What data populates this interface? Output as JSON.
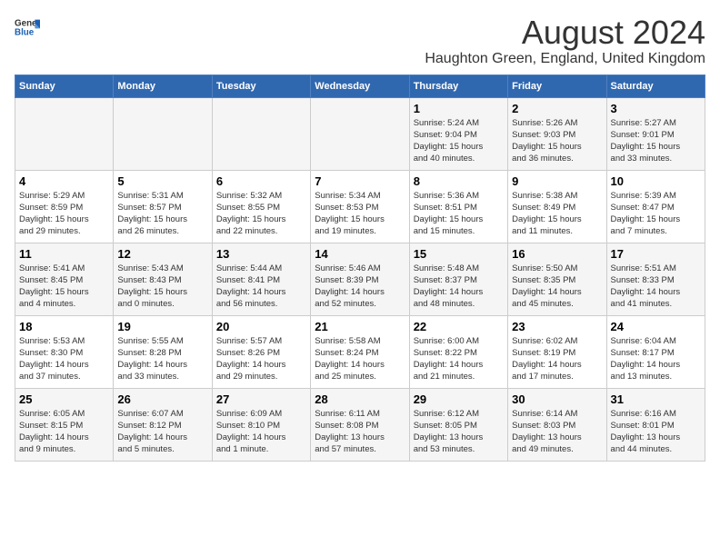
{
  "header": {
    "logo_general": "General",
    "logo_blue": "Blue",
    "title": "August 2024",
    "subtitle": "Haughton Green, England, United Kingdom"
  },
  "calendar": {
    "days_of_week": [
      "Sunday",
      "Monday",
      "Tuesday",
      "Wednesday",
      "Thursday",
      "Friday",
      "Saturday"
    ],
    "weeks": [
      [
        {
          "day": "",
          "info": ""
        },
        {
          "day": "",
          "info": ""
        },
        {
          "day": "",
          "info": ""
        },
        {
          "day": "",
          "info": ""
        },
        {
          "day": "1",
          "info": "Sunrise: 5:24 AM\nSunset: 9:04 PM\nDaylight: 15 hours\nand 40 minutes."
        },
        {
          "day": "2",
          "info": "Sunrise: 5:26 AM\nSunset: 9:03 PM\nDaylight: 15 hours\nand 36 minutes."
        },
        {
          "day": "3",
          "info": "Sunrise: 5:27 AM\nSunset: 9:01 PM\nDaylight: 15 hours\nand 33 minutes."
        }
      ],
      [
        {
          "day": "4",
          "info": "Sunrise: 5:29 AM\nSunset: 8:59 PM\nDaylight: 15 hours\nand 29 minutes."
        },
        {
          "day": "5",
          "info": "Sunrise: 5:31 AM\nSunset: 8:57 PM\nDaylight: 15 hours\nand 26 minutes."
        },
        {
          "day": "6",
          "info": "Sunrise: 5:32 AM\nSunset: 8:55 PM\nDaylight: 15 hours\nand 22 minutes."
        },
        {
          "day": "7",
          "info": "Sunrise: 5:34 AM\nSunset: 8:53 PM\nDaylight: 15 hours\nand 19 minutes."
        },
        {
          "day": "8",
          "info": "Sunrise: 5:36 AM\nSunset: 8:51 PM\nDaylight: 15 hours\nand 15 minutes."
        },
        {
          "day": "9",
          "info": "Sunrise: 5:38 AM\nSunset: 8:49 PM\nDaylight: 15 hours\nand 11 minutes."
        },
        {
          "day": "10",
          "info": "Sunrise: 5:39 AM\nSunset: 8:47 PM\nDaylight: 15 hours\nand 7 minutes."
        }
      ],
      [
        {
          "day": "11",
          "info": "Sunrise: 5:41 AM\nSunset: 8:45 PM\nDaylight: 15 hours\nand 4 minutes."
        },
        {
          "day": "12",
          "info": "Sunrise: 5:43 AM\nSunset: 8:43 PM\nDaylight: 15 hours\nand 0 minutes."
        },
        {
          "day": "13",
          "info": "Sunrise: 5:44 AM\nSunset: 8:41 PM\nDaylight: 14 hours\nand 56 minutes."
        },
        {
          "day": "14",
          "info": "Sunrise: 5:46 AM\nSunset: 8:39 PM\nDaylight: 14 hours\nand 52 minutes."
        },
        {
          "day": "15",
          "info": "Sunrise: 5:48 AM\nSunset: 8:37 PM\nDaylight: 14 hours\nand 48 minutes."
        },
        {
          "day": "16",
          "info": "Sunrise: 5:50 AM\nSunset: 8:35 PM\nDaylight: 14 hours\nand 45 minutes."
        },
        {
          "day": "17",
          "info": "Sunrise: 5:51 AM\nSunset: 8:33 PM\nDaylight: 14 hours\nand 41 minutes."
        }
      ],
      [
        {
          "day": "18",
          "info": "Sunrise: 5:53 AM\nSunset: 8:30 PM\nDaylight: 14 hours\nand 37 minutes."
        },
        {
          "day": "19",
          "info": "Sunrise: 5:55 AM\nSunset: 8:28 PM\nDaylight: 14 hours\nand 33 minutes."
        },
        {
          "day": "20",
          "info": "Sunrise: 5:57 AM\nSunset: 8:26 PM\nDaylight: 14 hours\nand 29 minutes."
        },
        {
          "day": "21",
          "info": "Sunrise: 5:58 AM\nSunset: 8:24 PM\nDaylight: 14 hours\nand 25 minutes."
        },
        {
          "day": "22",
          "info": "Sunrise: 6:00 AM\nSunset: 8:22 PM\nDaylight: 14 hours\nand 21 minutes."
        },
        {
          "day": "23",
          "info": "Sunrise: 6:02 AM\nSunset: 8:19 PM\nDaylight: 14 hours\nand 17 minutes."
        },
        {
          "day": "24",
          "info": "Sunrise: 6:04 AM\nSunset: 8:17 PM\nDaylight: 14 hours\nand 13 minutes."
        }
      ],
      [
        {
          "day": "25",
          "info": "Sunrise: 6:05 AM\nSunset: 8:15 PM\nDaylight: 14 hours\nand 9 minutes."
        },
        {
          "day": "26",
          "info": "Sunrise: 6:07 AM\nSunset: 8:12 PM\nDaylight: 14 hours\nand 5 minutes."
        },
        {
          "day": "27",
          "info": "Sunrise: 6:09 AM\nSunset: 8:10 PM\nDaylight: 14 hours\nand 1 minute."
        },
        {
          "day": "28",
          "info": "Sunrise: 6:11 AM\nSunset: 8:08 PM\nDaylight: 13 hours\nand 57 minutes."
        },
        {
          "day": "29",
          "info": "Sunrise: 6:12 AM\nSunset: 8:05 PM\nDaylight: 13 hours\nand 53 minutes."
        },
        {
          "day": "30",
          "info": "Sunrise: 6:14 AM\nSunset: 8:03 PM\nDaylight: 13 hours\nand 49 minutes."
        },
        {
          "day": "31",
          "info": "Sunrise: 6:16 AM\nSunset: 8:01 PM\nDaylight: 13 hours\nand 44 minutes."
        }
      ]
    ]
  }
}
